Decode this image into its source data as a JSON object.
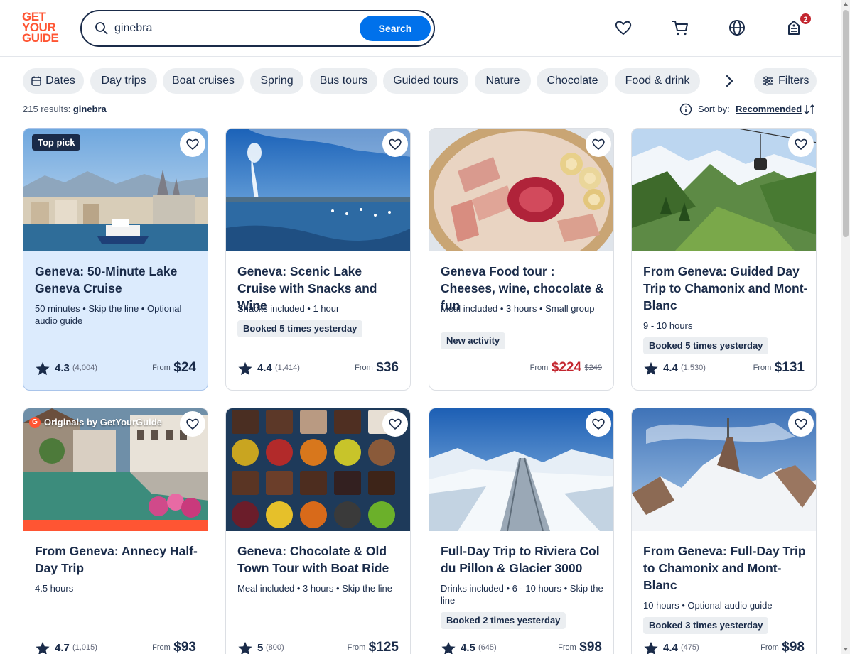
{
  "header": {
    "logo": [
      "GET",
      "YOUR",
      "GUIDE"
    ],
    "search_value": "ginebra",
    "search_button": "Search",
    "cart_badge": "2"
  },
  "chips": [
    {
      "label": "Dates",
      "icon": "calendar-icon"
    },
    {
      "label": "Day trips"
    },
    {
      "label": "Boat cruises"
    },
    {
      "label": "Spring"
    },
    {
      "label": "Bus tours"
    },
    {
      "label": "Guided tours"
    },
    {
      "label": "Nature"
    },
    {
      "label": "Chocolate"
    },
    {
      "label": "Food & drink"
    }
  ],
  "filters_label": "Filters",
  "results": {
    "count_text": "215 results:",
    "query": "ginebra",
    "sort_label": "Sort by:",
    "sort_value": "Recommended"
  },
  "cards": [
    {
      "title": "Geneva: 50-Minute Lake Geneva Cruise",
      "meta": "50 minutes • Skip the line • Optional audio guide",
      "tag": "",
      "badge": "Top pick",
      "rating": "4.3",
      "reviews": "(4,004)",
      "from": "From",
      "price": "$24",
      "old_price": ""
    },
    {
      "title": "Geneva: Scenic Lake Cruise with Snacks and Wine",
      "meta": "Snacks included • 1 hour",
      "tag": "Booked 5 times yesterday",
      "rating": "4.4",
      "reviews": "(1,414)",
      "from": "From",
      "price": "$36",
      "old_price": ""
    },
    {
      "title": "Geneva Food tour : Cheeses, wine, chocolate & fun",
      "meta": "Meal included • 3 hours • Small group",
      "tag": "New activity",
      "rating": "",
      "reviews": "",
      "from": "From",
      "price": "$224",
      "old_price": "$249"
    },
    {
      "title": "From Geneva: Guided Day Trip to Chamonix and Mont-Blanc",
      "meta": "9 - 10 hours",
      "tag": "Booked 5 times yesterday",
      "rating": "4.4",
      "reviews": "(1,530)",
      "from": "From",
      "price": "$131",
      "old_price": ""
    },
    {
      "title": "From Geneva: Annecy Half-Day Trip",
      "meta": "4.5 hours",
      "tag": "",
      "badge": "Originals by GetYourGuide",
      "rating": "4.7",
      "reviews": "(1,015)",
      "from": "From",
      "price": "$93",
      "old_price": ""
    },
    {
      "title": "Geneva: Chocolate & Old Town Tour with Boat Ride",
      "meta": "Meal included • 3 hours • Skip the line",
      "tag": "",
      "rating": "5",
      "reviews": "(800)",
      "from": "From",
      "price": "$125",
      "old_price": ""
    },
    {
      "title": "Full-Day Trip to Riviera Col du Pillon & Glacier 3000",
      "meta": "Drinks included • 6 - 10 hours • Skip the line",
      "tag": "Booked 2 times yesterday",
      "rating": "4.5",
      "reviews": "(645)",
      "from": "From",
      "price": "$98",
      "old_price": ""
    },
    {
      "title": "From Geneva: Full-Day Trip to Chamonix and Mont-Blanc",
      "meta": "10 hours • Optional audio guide",
      "tag": "Booked 3 times yesterday",
      "rating": "4.4",
      "reviews": "(475)",
      "from": "From",
      "price": "$98",
      "old_price": ""
    }
  ],
  "colors": {
    "brand": "#ff5533",
    "accent": "#0071eb",
    "sale": "#c3262f",
    "text": "#1a2b49"
  }
}
